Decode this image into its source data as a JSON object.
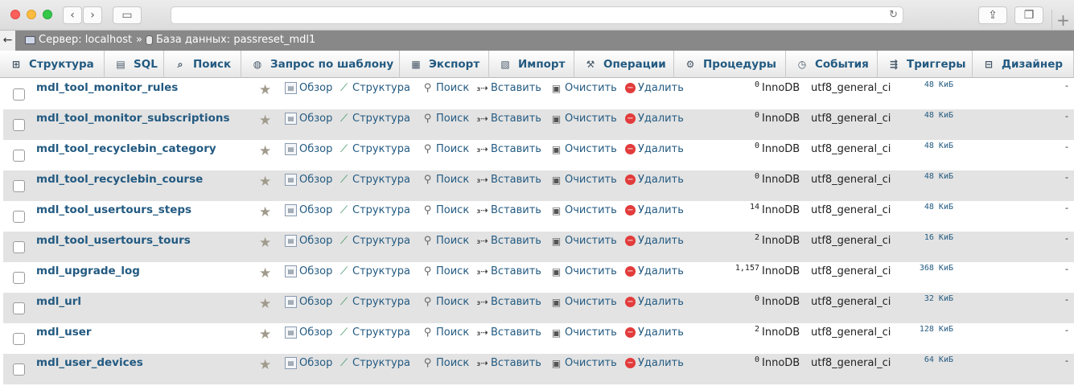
{
  "breadcrumb": {
    "server_label": "Сервер: localhost",
    "separator": "»",
    "database_label": "База данных: passreset_mdl1"
  },
  "tabs": [
    {
      "label": "Структура",
      "icon": "structure-icon"
    },
    {
      "label": "SQL",
      "icon": "sql-icon"
    },
    {
      "label": "Поиск",
      "icon": "search-icon"
    },
    {
      "label": "Запрос по шаблону",
      "icon": "query-icon"
    },
    {
      "label": "Экспорт",
      "icon": "export-icon"
    },
    {
      "label": "Импорт",
      "icon": "import-icon"
    },
    {
      "label": "Операции",
      "icon": "wrench-icon"
    },
    {
      "label": "Процедуры",
      "icon": "routines-icon"
    },
    {
      "label": "События",
      "icon": "clock-icon"
    },
    {
      "label": "Триггеры",
      "icon": "triggers-icon"
    },
    {
      "label": "Дизайнер",
      "icon": "designer-icon"
    }
  ],
  "actions": {
    "browse": "Обзор",
    "structure": "Структура",
    "search": "Поиск",
    "insert": "Вставить",
    "empty": "Очистить",
    "drop": "Удалить"
  },
  "tables": [
    {
      "name": "mdl_tool_monitor_rules",
      "rows": "0",
      "engine": "InnoDB",
      "collation": "utf8_general_ci",
      "size": "48 КиБ",
      "overhead": "-"
    },
    {
      "name": "mdl_tool_monitor_subscriptions",
      "rows": "0",
      "engine": "InnoDB",
      "collation": "utf8_general_ci",
      "size": "48 КиБ",
      "overhead": "-"
    },
    {
      "name": "mdl_tool_recyclebin_category",
      "rows": "0",
      "engine": "InnoDB",
      "collation": "utf8_general_ci",
      "size": "48 КиБ",
      "overhead": "-"
    },
    {
      "name": "mdl_tool_recyclebin_course",
      "rows": "0",
      "engine": "InnoDB",
      "collation": "utf8_general_ci",
      "size": "48 КиБ",
      "overhead": "-"
    },
    {
      "name": "mdl_tool_usertours_steps",
      "rows": "14",
      "engine": "InnoDB",
      "collation": "utf8_general_ci",
      "size": "48 КиБ",
      "overhead": "-"
    },
    {
      "name": "mdl_tool_usertours_tours",
      "rows": "2",
      "engine": "InnoDB",
      "collation": "utf8_general_ci",
      "size": "16 КиБ",
      "overhead": "-"
    },
    {
      "name": "mdl_upgrade_log",
      "rows": "1,157",
      "engine": "InnoDB",
      "collation": "utf8_general_ci",
      "size": "368 КиБ",
      "overhead": "-"
    },
    {
      "name": "mdl_url",
      "rows": "0",
      "engine": "InnoDB",
      "collation": "utf8_general_ci",
      "size": "32 КиБ",
      "overhead": "-"
    },
    {
      "name": "mdl_user",
      "rows": "2",
      "engine": "InnoDB",
      "collation": "utf8_general_ci",
      "size": "128 КиБ",
      "overhead": "-"
    },
    {
      "name": "mdl_user_devices",
      "rows": "0",
      "engine": "InnoDB",
      "collation": "utf8_general_ci",
      "size": "64 КиБ",
      "overhead": "-"
    }
  ]
}
